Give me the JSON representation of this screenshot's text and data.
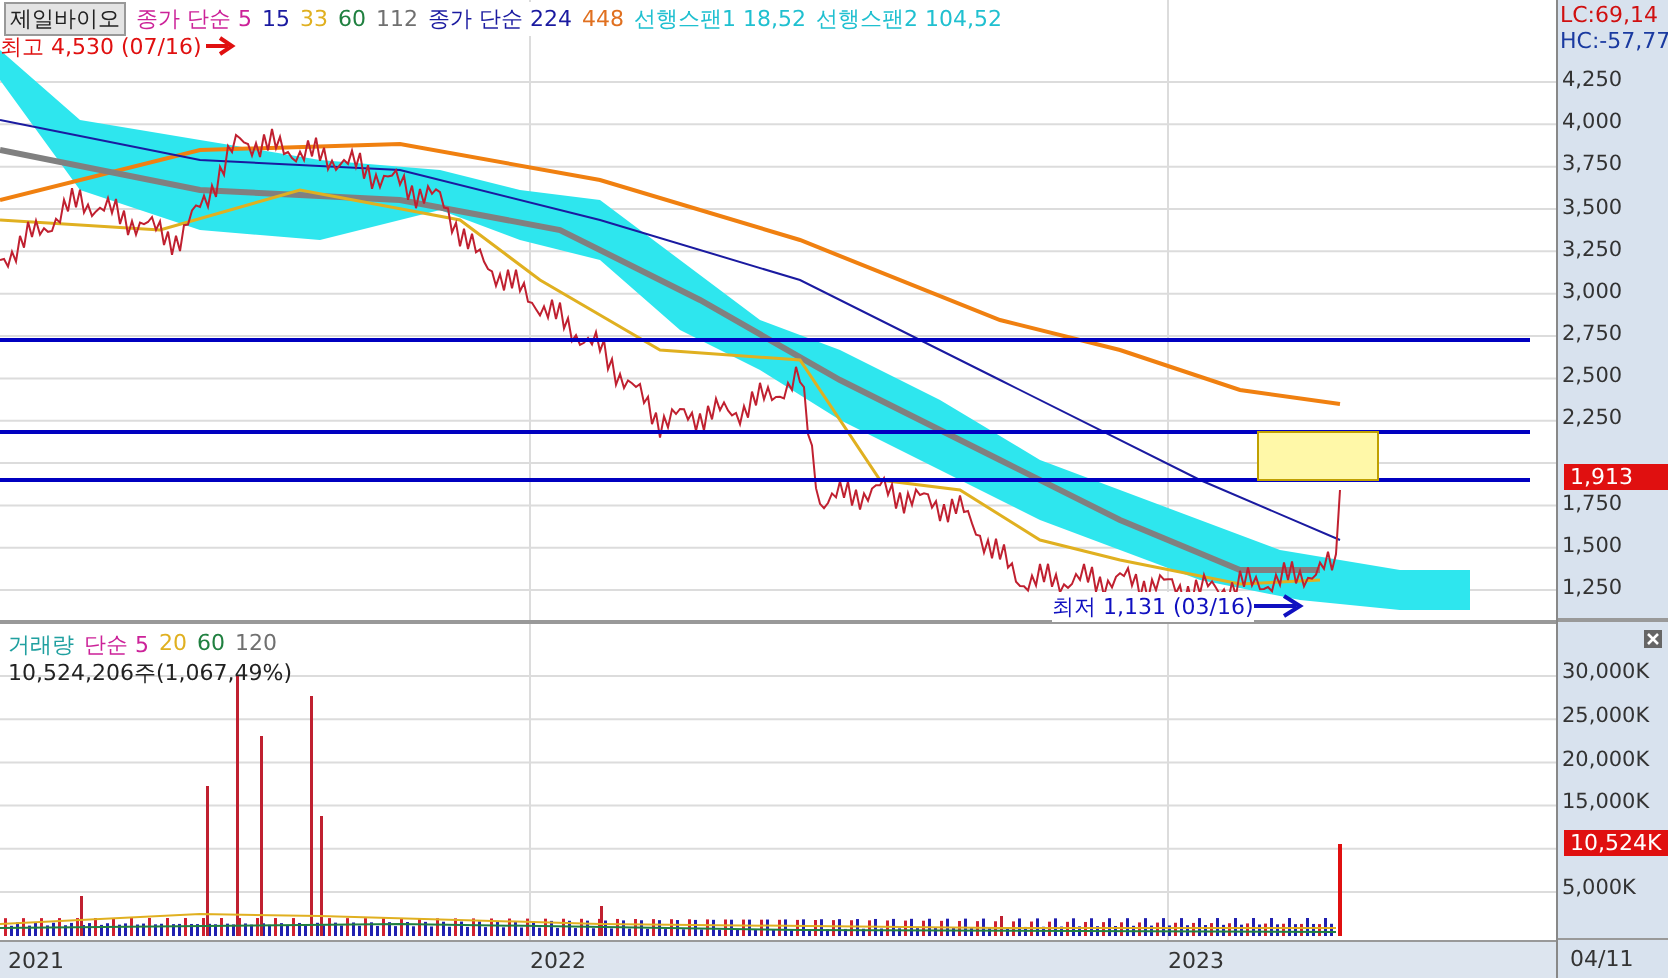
{
  "stock": {
    "name": "제일바이오"
  },
  "price_legend_1": [
    {
      "text": "종가 단순 5",
      "color": "#cc2299"
    },
    {
      "text": "15",
      "color": "#1a1aa0"
    },
    {
      "text": "33",
      "color": "#e0b020"
    },
    {
      "text": "60",
      "color": "#208040"
    },
    {
      "text": "112",
      "color": "#707070"
    }
  ],
  "price_legend_2": [
    {
      "text": "종가 단순 224",
      "color": "#1a1aa0"
    },
    {
      "text": "448",
      "color": "#e07020"
    },
    {
      "text": "선행스팬1 18,52",
      "color": "#20c0d0"
    },
    {
      "text": "선행스팬2 104,52",
      "color": "#20c0d0"
    }
  ],
  "indicators": {
    "lc": "LC:69,14",
    "hc": "HC:-57,77"
  },
  "annotations": {
    "high": "최고 4,530 (07/16)",
    "low": "최저 1,131 (03/16)"
  },
  "price_axis": [
    "4,250",
    "4,000",
    "3,750",
    "3,500",
    "3,250",
    "3,000",
    "2,750",
    "2,500",
    "2,250",
    "1,750",
    "1,500",
    "1,250"
  ],
  "current_price": "1,913",
  "volume_legend": [
    {
      "text": "거래량",
      "color": "#20a0a0"
    },
    {
      "text": "단순 5",
      "color": "#cc2299"
    },
    {
      "text": "20",
      "color": "#e0b020"
    },
    {
      "text": "60",
      "color": "#208040"
    },
    {
      "text": "120",
      "color": "#707070"
    }
  ],
  "volume_summary": "10,524,206주(1,067,49%)",
  "volume_axis": [
    "30,000K",
    "25,000K",
    "20,000K",
    "15,000K",
    "5,000K"
  ],
  "current_volume": "10,524K",
  "x_axis": [
    "2021",
    "2022",
    "2023"
  ],
  "last_date": "04/11"
}
